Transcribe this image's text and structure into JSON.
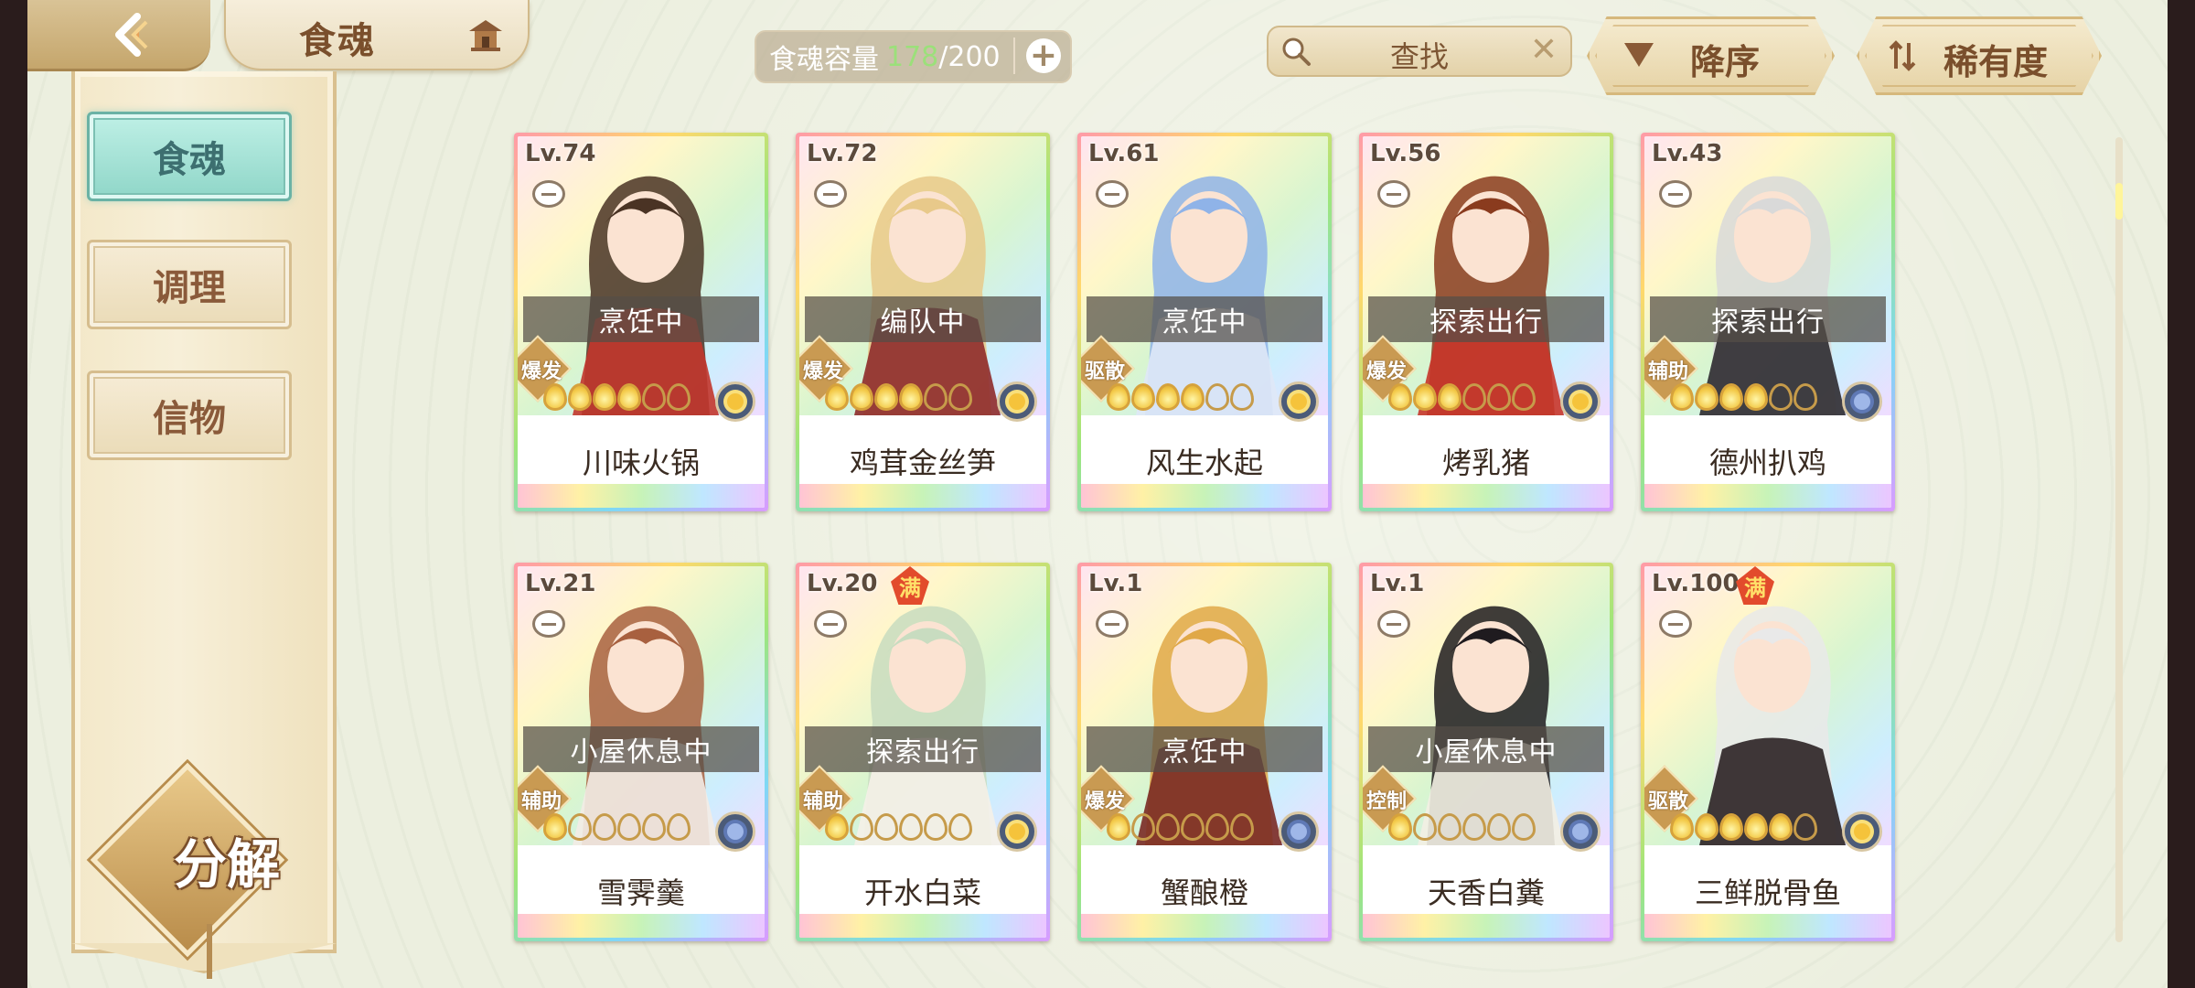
{
  "header": {
    "title": "食魂",
    "capacity": {
      "label": "食魂容量",
      "current": "178",
      "separator": "/",
      "max": "200",
      "plus": "+"
    },
    "search": {
      "text": "查找"
    },
    "sort_order_label": "降序",
    "sort_by_label": "稀有度"
  },
  "sidebar": {
    "items": [
      {
        "label": "食魂",
        "active": true
      },
      {
        "label": "调理",
        "active": false
      },
      {
        "label": "信物",
        "active": false
      }
    ],
    "decompose_label": "分解"
  },
  "cards": [
    {
      "level": "Lv.74",
      "status": "烹饪中",
      "role": "爆发",
      "stars": 4,
      "element": "gold",
      "name": "川味火锅",
      "full": ""
    },
    {
      "level": "Lv.72",
      "status": "编队中",
      "role": "爆发",
      "stars": 4,
      "element": "gold",
      "name": "鸡茸金丝笋",
      "full": ""
    },
    {
      "level": "Lv.61",
      "status": "烹饪中",
      "role": "驱散",
      "stars": 4,
      "element": "gold",
      "name": "风生水起",
      "full": ""
    },
    {
      "level": "Lv.56",
      "status": "探索出行",
      "role": "爆发",
      "stars": 3,
      "element": "gold",
      "name": "烤乳猪",
      "full": ""
    },
    {
      "level": "Lv.43",
      "status": "探索出行",
      "role": "辅助",
      "stars": 4,
      "element": "blue",
      "name": "德州扒鸡",
      "full": ""
    },
    {
      "level": "Lv.21",
      "status": "小屋休息中",
      "role": "辅助",
      "stars": 1,
      "element": "blue",
      "name": "雪霁羹",
      "full": ""
    },
    {
      "level": "Lv.20",
      "status": "探索出行",
      "role": "辅助",
      "stars": 1,
      "element": "gold",
      "name": "开水白菜",
      "full": "满"
    },
    {
      "level": "Lv.1",
      "status": "烹饪中",
      "role": "爆发",
      "stars": 1,
      "element": "blue",
      "name": "蟹酿橙",
      "full": ""
    },
    {
      "level": "Lv.1",
      "status": "小屋休息中",
      "role": "控制",
      "stars": 1,
      "element": "blue",
      "name": "天香白糞",
      "full": ""
    },
    {
      "level": "Lv.100",
      "status": "",
      "role": "驱散",
      "stars": 5,
      "element": "gold",
      "name": "三鲜脱骨鱼",
      "full": "满"
    }
  ],
  "colors": {
    "accent_teal": "#8fd6c8",
    "frame_gold": "#d6b87c",
    "capacity_highlight": "#9be07a"
  }
}
